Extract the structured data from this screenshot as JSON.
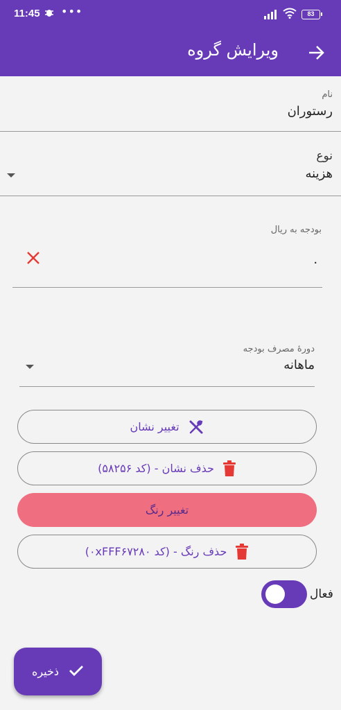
{
  "status_bar": {
    "time": "11:45",
    "battery": "83",
    "icons": [
      "bug-icon",
      "more-dots-icon",
      "signal-icon",
      "wifi-icon",
      "battery-icon"
    ]
  },
  "app_bar": {
    "title": "ویرایش گروه",
    "back_icon": "arrow-back-icon"
  },
  "form": {
    "name": {
      "label": "نام",
      "value": "رستوران"
    },
    "type": {
      "label": "نوع",
      "value": "هزینه"
    },
    "budget": {
      "label": "بودجه به ریال",
      "value": "۰"
    },
    "budget_period": {
      "label": "دورهٔ مصرف بودجه",
      "value": "ماهانه"
    }
  },
  "buttons": {
    "change_icon": "تغییر نشان",
    "delete_icon": "حذف نشان - (کد ۵۸۲۵۶)",
    "change_color": "تغییر رنگ",
    "delete_color": "حذف رنگ - (کد ۰xFFF۶۷۲۸۰)"
  },
  "active": {
    "label": "فعال",
    "enabled": true
  },
  "fab": {
    "label": "ذخیره"
  },
  "colors": {
    "primary": "#673ab7",
    "accent_pink": "#ef6e80",
    "danger": "#e53935",
    "background": "#f3f3f3"
  }
}
